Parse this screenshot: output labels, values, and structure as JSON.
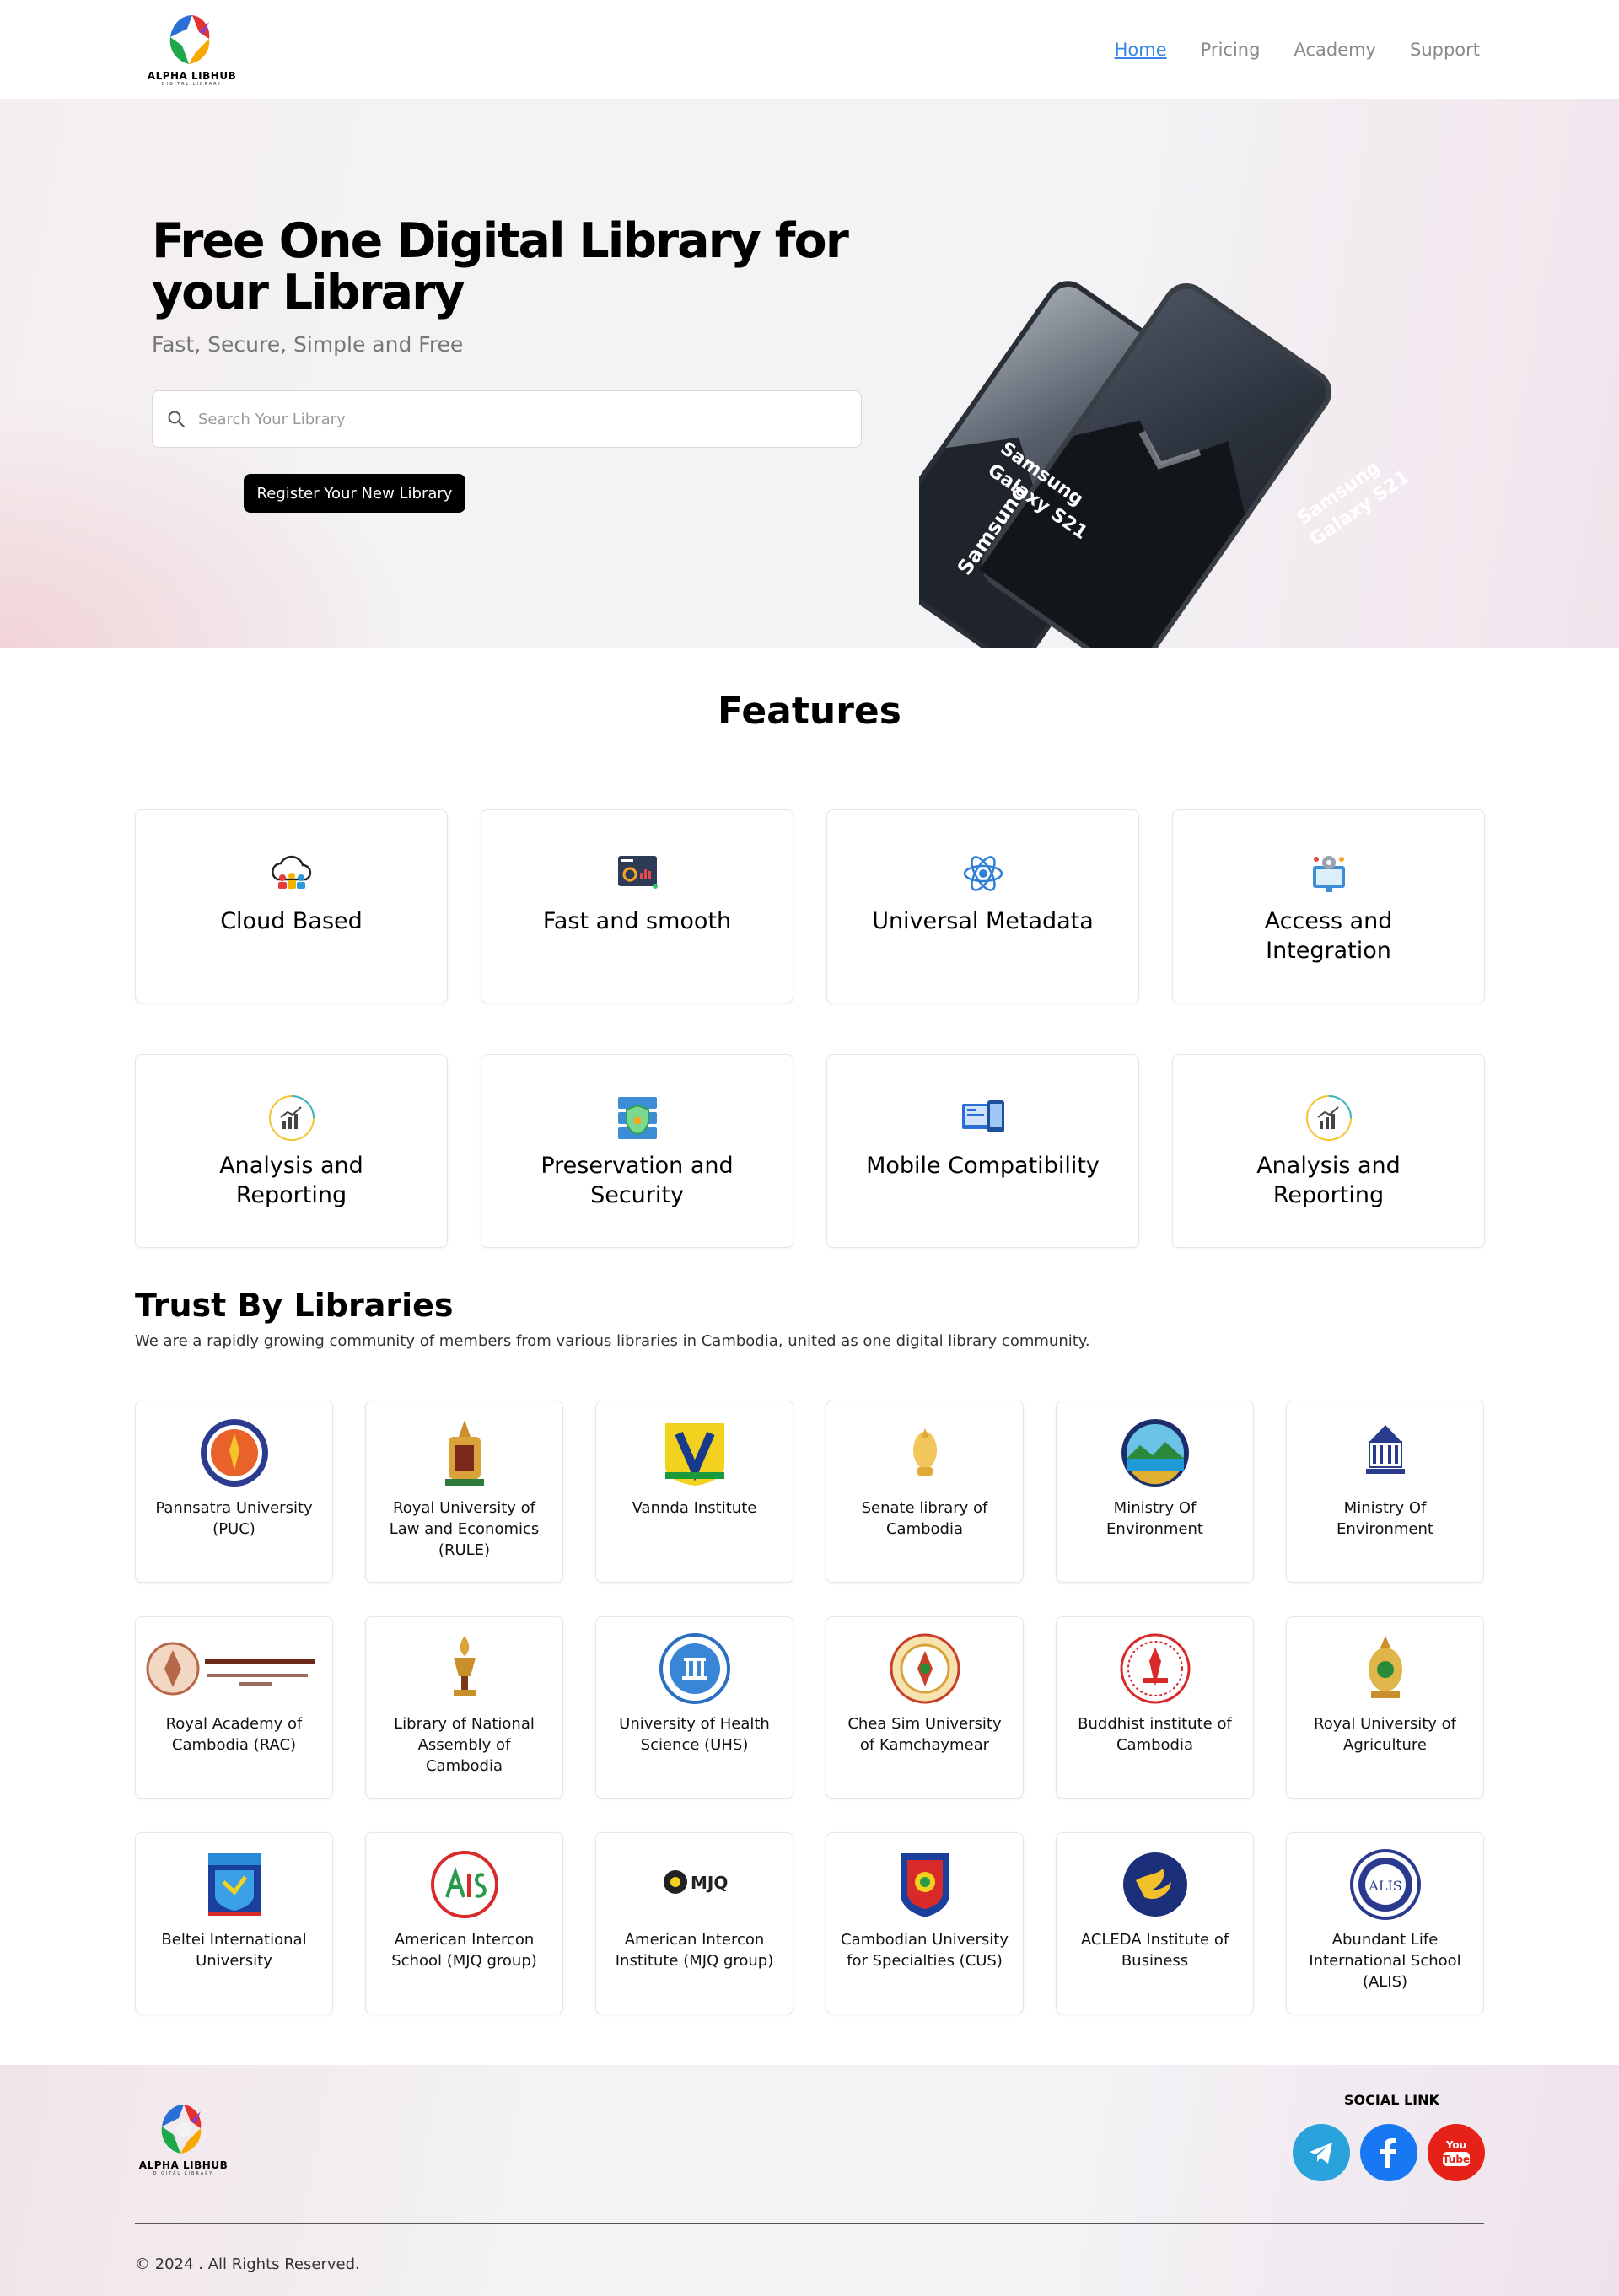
{
  "brand": {
    "name": "ALPHA LIBHUB",
    "tagline": "DIGITAL LIBRARY"
  },
  "nav": [
    {
      "label": "Home",
      "active": true
    },
    {
      "label": "Pricing"
    },
    {
      "label": "Academy"
    },
    {
      "label": "Support"
    }
  ],
  "hero": {
    "title_line1": "Free One Digital Library for",
    "title_line2": "your Library",
    "subtitle": "Fast, Secure, Simple and Free",
    "search_placeholder": "Search Your Library",
    "register_label": "Register Your New Library",
    "phone_label_line1": "Samsung",
    "phone_label_line2": "Galaxy S21"
  },
  "features": {
    "title": "Features",
    "items": [
      {
        "label": "Cloud Based",
        "icon": "cloud-users-icon"
      },
      {
        "label": "Fast and smooth",
        "icon": "speed-dashboard-icon"
      },
      {
        "label": "Universal Metadata",
        "icon": "atom-network-icon"
      },
      {
        "label": "Access and Integration",
        "icon": "gear-monitor-icon"
      },
      {
        "label": "Analysis and Reporting",
        "icon": "analytics-icon"
      },
      {
        "label": "Preservation and Security",
        "icon": "server-shield-icon"
      },
      {
        "label": "Mobile Compatibility",
        "icon": "devices-icon"
      },
      {
        "label": "Analysis and Reporting",
        "icon": "analytics-icon"
      }
    ]
  },
  "trust": {
    "title": "Trust By Libraries",
    "subtitle": "We are a rapidly growing community of members from various libraries in Cambodia, united as one digital library community.",
    "libraries": [
      {
        "name": "Pannsatra University (PUC)"
      },
      {
        "name": "Royal University of Law and Economics (RULE)"
      },
      {
        "name": "Vannda Institute"
      },
      {
        "name": "Senate library of Cambodia"
      },
      {
        "name": "Ministry Of Environment"
      },
      {
        "name": "Ministry Of Environment"
      },
      {
        "name": "Royal Academy of Cambodia (RAC)"
      },
      {
        "name": "Library of National Assembly of Cambodia"
      },
      {
        "name": "University of Health Science (UHS)"
      },
      {
        "name": "Chea Sim University of Kamchaymear"
      },
      {
        "name": "Buddhist institute of Cambodia"
      },
      {
        "name": "Royal University of Agriculture"
      },
      {
        "name": "Beltei International University"
      },
      {
        "name": "American Intercon School (MJQ group)"
      },
      {
        "name": "American Intercon Institute (MJQ group)"
      },
      {
        "name": "Cambodian University for Specialties (CUS)"
      },
      {
        "name": "ACLEDA Institute of Business"
      },
      {
        "name": "Abundant Life International School (ALIS)"
      }
    ]
  },
  "footer": {
    "social_title": "SOCIAL LINK",
    "socials": [
      {
        "name": "Telegram",
        "icon": "telegram-icon",
        "color": "#2aa3dc"
      },
      {
        "name": "Facebook",
        "icon": "facebook-icon",
        "color": "#1877f2"
      },
      {
        "name": "YouTube",
        "icon": "youtube-icon",
        "color": "#e62117"
      }
    ],
    "copyright": "© 2024 . All Rights Reserved."
  },
  "colors": {
    "accent": "#3a86e8",
    "button": "#000000"
  }
}
